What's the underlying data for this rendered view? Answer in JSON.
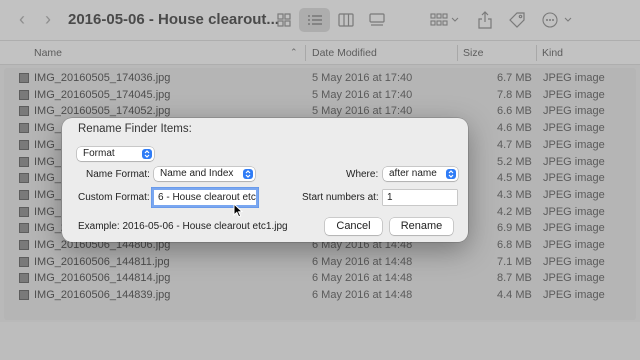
{
  "window": {
    "title": "2016-05-06 - House clearout...",
    "back_icon": "chevron-left-icon",
    "forward_icon": "chevron-right-icon"
  },
  "toolbar": {
    "view_modes": [
      "icon-view-icon",
      "list-view-icon",
      "column-view-icon",
      "gallery-view-icon"
    ],
    "active_view": "list",
    "actions": [
      "group-icon",
      "share-icon",
      "tag-icon",
      "more-icon"
    ]
  },
  "columns": {
    "name": "Name",
    "date": "Date Modified",
    "size": "Size",
    "kind": "Kind"
  },
  "files": [
    {
      "name": "IMG_20160505_174036.jpg",
      "date": "5 May 2016 at 17:40",
      "size": "6.7 MB",
      "kind": "JPEG image"
    },
    {
      "name": "IMG_20160505_174045.jpg",
      "date": "5 May 2016 at 17:40",
      "size": "7.8 MB",
      "kind": "JPEG image"
    },
    {
      "name": "IMG_20160505_174052.jpg",
      "date": "5 May 2016 at 17:40",
      "size": "6.6 MB",
      "kind": "JPEG image"
    },
    {
      "name": "IMG_",
      "date": "",
      "size": "4.6 MB",
      "kind": "JPEG image"
    },
    {
      "name": "IMG_",
      "date": "",
      "size": "4.7 MB",
      "kind": "JPEG image"
    },
    {
      "name": "IMG_",
      "date": "",
      "size": "5.2 MB",
      "kind": "JPEG image"
    },
    {
      "name": "IMG_",
      "date": "",
      "size": "4.5 MB",
      "kind": "JPEG image"
    },
    {
      "name": "IMG_",
      "date": "",
      "size": "4.3 MB",
      "kind": "JPEG image"
    },
    {
      "name": "IMG_",
      "date": "",
      "size": "4.2 MB",
      "kind": "JPEG image"
    },
    {
      "name": "IMG_20160506_144802.jpg",
      "date": "6 May 2016 at 14:48",
      "size": "6.9 MB",
      "kind": "JPEG image"
    },
    {
      "name": "IMG_20160506_144806.jpg",
      "date": "6 May 2016 at 14:48",
      "size": "6.8 MB",
      "kind": "JPEG image"
    },
    {
      "name": "IMG_20160506_144811.jpg",
      "date": "6 May 2016 at 14:48",
      "size": "7.1 MB",
      "kind": "JPEG image"
    },
    {
      "name": "IMG_20160506_144814.jpg",
      "date": "6 May 2016 at 14:48",
      "size": "8.7 MB",
      "kind": "JPEG image"
    },
    {
      "name": "IMG_20160506_144839.jpg",
      "date": "6 May 2016 at 14:48",
      "size": "4.4 MB",
      "kind": "JPEG image"
    }
  ],
  "dialog": {
    "title": "Rename Finder Items:",
    "mode": "Format",
    "name_format_label": "Name Format:",
    "name_format_value": "Name and Index",
    "where_label": "Where:",
    "where_value": "after name",
    "custom_format_label": "Custom Format:",
    "custom_format_value": "6 - House clearout etc",
    "start_numbers_label": "Start numbers at:",
    "start_numbers_value": "1",
    "example": "Example: 2016-05-06 - House clearout etc1.jpg",
    "cancel_label": "Cancel",
    "rename_label": "Rename",
    "accent_color": "#2f7cf6"
  }
}
